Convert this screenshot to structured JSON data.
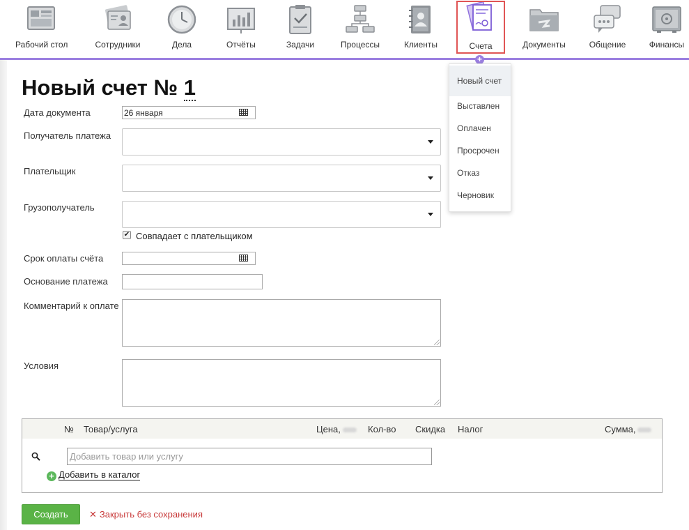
{
  "nav": {
    "items": [
      {
        "label": "Рабочий стол",
        "icon": "desktop-icon"
      },
      {
        "label": "Сотрудники",
        "icon": "employees-icon"
      },
      {
        "label": "Дела",
        "icon": "clock-icon"
      },
      {
        "label": "Отчёты",
        "icon": "reports-chart-icon"
      },
      {
        "label": "Задачи",
        "icon": "clipboard-check-icon"
      },
      {
        "label": "Процессы",
        "icon": "flowchart-icon"
      },
      {
        "label": "Клиенты",
        "icon": "contacts-book-icon"
      },
      {
        "label": "Счета",
        "icon": "invoices-icon",
        "active": true
      },
      {
        "label": "Документы",
        "icon": "folder-icon"
      },
      {
        "label": "Общение",
        "icon": "chat-bubbles-icon"
      },
      {
        "label": "Финансы",
        "icon": "safe-icon"
      }
    ],
    "accent_color": "#9b7fe0",
    "active_border_color": "#e05555"
  },
  "dropdown": {
    "items": [
      "Новый счет",
      "Выставлен",
      "Оплачен",
      "Просрочен",
      "Отказ",
      "Черновик"
    ]
  },
  "page": {
    "title_prefix": "Новый счет №",
    "title_number": "1"
  },
  "form": {
    "doc_date_label": "Дата документа",
    "doc_date_value": "26 января",
    "recipient_label": "Получатель платежа",
    "payer_label": "Плательщик",
    "consignee_label": "Грузополучатель",
    "same_as_payer_label": "Совпадает с плательщиком",
    "same_as_payer_checked": true,
    "due_date_label": "Срок оплаты счёта",
    "payment_basis_label": "Основание платежа",
    "payment_comment_label": "Комментарий к оплате",
    "terms_label": "Условия"
  },
  "table": {
    "col_num": "№",
    "col_item": "Товар/услуга",
    "col_price": "Цена,",
    "col_qty": "Кол-во",
    "col_discount": "Скидка",
    "col_tax": "Налог",
    "col_sum": "Сумма,",
    "add_placeholder": "Добавить товар или услугу",
    "add_catalog": "Добавить в каталог"
  },
  "actions": {
    "create": "Создать",
    "close_without_saving": "Закрыть без сохранения",
    "create_color": "#5ab346",
    "close_color": "#c83a3a"
  }
}
